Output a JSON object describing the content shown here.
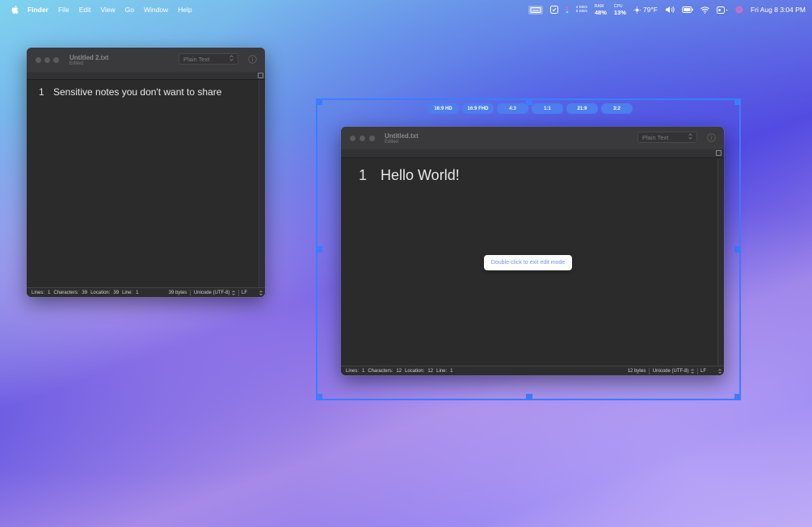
{
  "menubar": {
    "items": [
      "Finder",
      "File",
      "Edit",
      "View",
      "Go",
      "Window",
      "Help"
    ],
    "network": {
      "up": "4 KB/s",
      "down": "6 KB/s"
    },
    "ram": {
      "label": "RAM",
      "value": "48%"
    },
    "cpu": {
      "label": "CPU",
      "value": "13%"
    },
    "weather": "79°F",
    "clock": "Fri Aug 8  3:04 PM"
  },
  "window_left": {
    "title": "Untitled 2.txt",
    "subtitle": "Edited",
    "format": "Plain Text",
    "line_number": "1",
    "line_text": "Sensitive notes you don't want to share",
    "status": {
      "lines_label": "Lines:",
      "lines": "1",
      "chars_label": "Characters:",
      "chars": "39",
      "loc_label": "Location:",
      "loc": "39",
      "line_label": "Line:",
      "line": "1",
      "bytes": "39 bytes",
      "encoding": "Unicode (UTF-8)",
      "eol": "LF"
    }
  },
  "window_right": {
    "title": "Untitled.txt",
    "subtitle": "Edited",
    "format": "Plain Text",
    "line_number": "1",
    "line_text": "Hello World!",
    "status": {
      "lines_label": "Lines:",
      "lines": "1",
      "chars_label": "Characters:",
      "chars": "12",
      "loc_label": "Location:",
      "loc": "12",
      "line_label": "Line:",
      "line": "1",
      "bytes": "12 bytes",
      "encoding": "Unicode (UTF-8)",
      "eol": "LF"
    }
  },
  "capture": {
    "ratios": [
      "16:9 HD",
      "16:9 FHD",
      "4:3",
      "1:1",
      "21:9",
      "3:2"
    ],
    "hint": "Double-click to exit edit mode"
  },
  "colors": {
    "accent": "#3d7cff",
    "ratio_button": "#4d7eee",
    "window_bg": "#2b2b2b",
    "titlebar": "#3a3a3c"
  }
}
